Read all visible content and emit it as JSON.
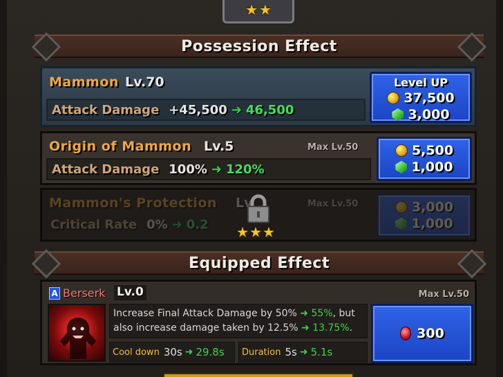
{
  "header": {
    "stars": 2
  },
  "possession": {
    "title": "Possession Effect",
    "rows": [
      {
        "name": "Mammon",
        "level": "Lv.70",
        "stat_label": "Attack Damage",
        "from": "+45,500",
        "to": "46,500",
        "button": {
          "label": "Level UP",
          "coins": "37,500",
          "gems": "3,000"
        }
      },
      {
        "name": "Origin of Mammon",
        "level": "Lv.5",
        "max_level": "Max Lv.50",
        "stat_label": "Attack Damage",
        "from": "100%",
        "to": "120%",
        "button": {
          "coins": "5,500",
          "gems": "1,000"
        }
      },
      {
        "name": "Mammon's Protection",
        "level": "Lv",
        "max_level": "Max Lv.50",
        "stat_label": "Critical Rate",
        "from": "0%",
        "to": "0.2",
        "button": {
          "coins": "3,000",
          "gems": "1,000"
        },
        "locked": true,
        "unlock_stars": 3
      }
    ]
  },
  "equipped": {
    "title": "Equipped Effect",
    "skill": {
      "badge": "A",
      "name": "Berserk",
      "level": "Lv.0",
      "max_level": "Max Lv.50",
      "desc_line1_a": "Increase Final Attack Damage by 50%",
      "desc_line1_b": "55%",
      "desc_line1_c": ", but",
      "desc_line2_a": "also increase damage taken by 12.5%",
      "desc_line2_b": "13.75%",
      "desc_line2_c": ".",
      "cooldown_label": "Cool down",
      "cooldown_from": "30s",
      "cooldown_to": "29.8s",
      "duration_label": "Duration",
      "duration_from": "5s",
      "duration_to": "5.1s",
      "cost": "300"
    }
  },
  "colors": {
    "accent_orange": "#f0a73c",
    "green": "#3fe05a",
    "button_blue": "#2456e6"
  },
  "icons": [
    "star-icon",
    "coin-icon",
    "gem-icon",
    "lock-icon",
    "ruby-icon",
    "arrow-right-icon"
  ]
}
